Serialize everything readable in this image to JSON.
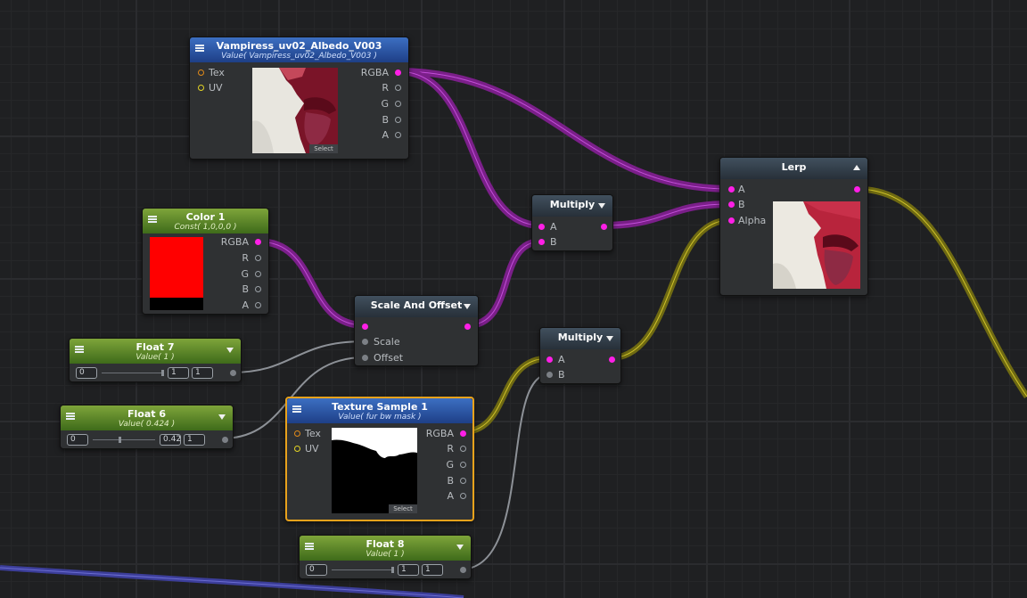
{
  "nodes": {
    "albedo": {
      "title": "Vampiress_uv02_Albedo_V003",
      "subtitle": "Value( Vampiress_uv02_Albedo_V003 )",
      "inputs": [
        "Tex",
        "UV"
      ],
      "outputs": [
        "RGBA",
        "R",
        "G",
        "B",
        "A"
      ],
      "select_label": "Select"
    },
    "color1": {
      "title": "Color 1",
      "subtitle": "Const( 1,0,0,0 )",
      "outputs": [
        "RGBA",
        "R",
        "G",
        "B",
        "A"
      ],
      "swatch_color": "#ff0000"
    },
    "float7": {
      "title": "Float 7",
      "subtitle": "Value( 1 )",
      "min": "0",
      "value": "1",
      "max": "1",
      "level": 1
    },
    "float6": {
      "title": "Float 6",
      "subtitle": "Value( 0.424 )",
      "min": "0",
      "value": "0.42",
      "max": "1",
      "level": 0.424
    },
    "float8": {
      "title": "Float 8",
      "subtitle": "Value( 1 )",
      "min": "0",
      "value": "1",
      "max": "1",
      "level": 1
    },
    "scale_offset": {
      "title": "Scale And Offset",
      "inputs": [
        "Scale",
        "Offset"
      ]
    },
    "multiply1": {
      "title": "Multiply",
      "inputs": [
        "A",
        "B"
      ]
    },
    "multiply2": {
      "title": "Multiply",
      "inputs": [
        "A",
        "B"
      ]
    },
    "lerp": {
      "title": "Lerp",
      "inputs": [
        "A",
        "B",
        "Alpha"
      ]
    },
    "texture_sample": {
      "title": "Texture Sample 1",
      "subtitle": "Value( fur bw mask )",
      "inputs": [
        "Tex",
        "UV"
      ],
      "outputs": [
        "RGBA",
        "R",
        "G",
        "B",
        "A"
      ],
      "select_label": "Select"
    }
  },
  "colors": {
    "texture_header": "#2a56a8",
    "param_header": "#5e8a2a",
    "operator_header": "#34404b",
    "selection_outline": "#e8a21c",
    "rgba_wire": "#b02fc0",
    "float_wire": "#b8a91a",
    "scalar_wire": "#8d9197"
  }
}
